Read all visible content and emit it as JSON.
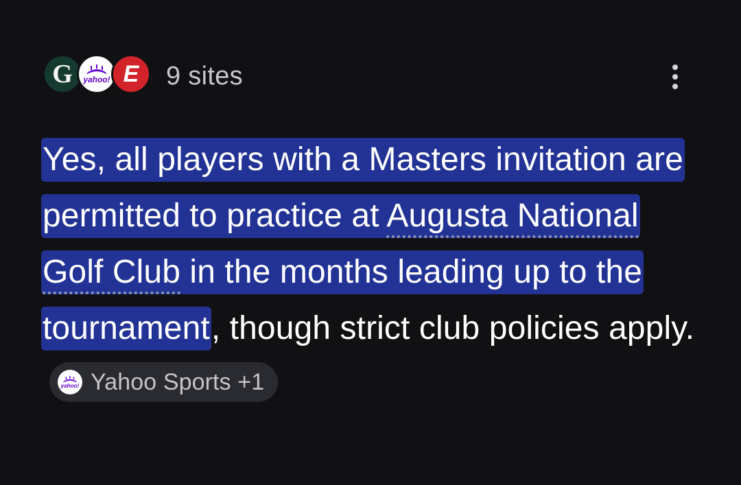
{
  "header": {
    "favicons": [
      {
        "name": "golf-digest-favicon",
        "glyph": "G",
        "color": "#153b30"
      },
      {
        "name": "yahoo-sports-favicon",
        "glyph": "yahoo!",
        "color": "#6001d2"
      },
      {
        "name": "espn-favicon",
        "glyph": "E",
        "color": "#d2232a"
      }
    ],
    "sites_count": "9 sites",
    "more_icon": "more-vert-icon"
  },
  "answer": {
    "highlight_line_1": "Yes, all players with a Masters invitation are permitted to practice at ",
    "entity": "Augusta National Golf Club",
    "highlight_line_2": " in the months leading up to the tournament",
    "after_highlight": ", though strict club policies apply.",
    "citation": {
      "label": "Yahoo Sports +1",
      "icon_glyph": "yahoo!",
      "icon": "yahoo-sports-icon"
    }
  },
  "colors": {
    "background": "#111114",
    "highlight": "#223395",
    "chip_background": "#2a2b30",
    "muted_text": "#c8c8cc"
  }
}
